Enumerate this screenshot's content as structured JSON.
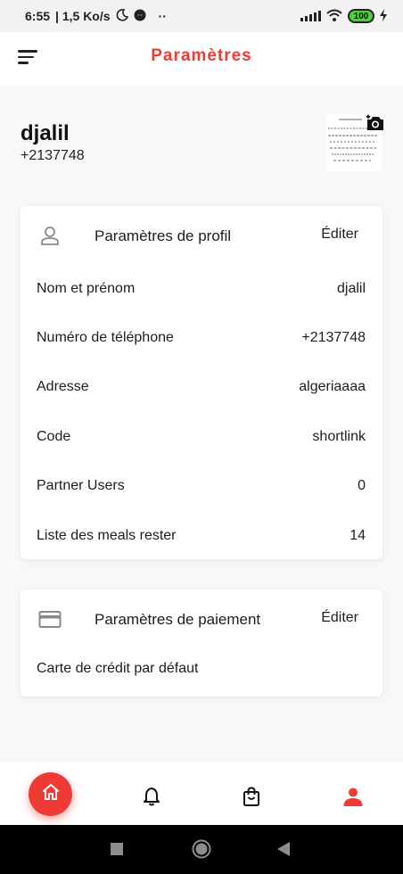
{
  "status_bar": {
    "time": "6:55",
    "speed": "| 1,5 Ko/s",
    "dots": "··",
    "battery": "100"
  },
  "header": {
    "title": "Paramètres"
  },
  "profile": {
    "name": "djalil",
    "phone": "+2137748"
  },
  "profile_settings": {
    "title": "Paramètres de profil",
    "edit_label": "Éditer",
    "rows": [
      {
        "label": "Nom et prénom",
        "value": "djalil"
      },
      {
        "label": "Numéro de téléphone",
        "value": "+2137748"
      },
      {
        "label": "Adresse",
        "value": "algeriaaaa"
      },
      {
        "label": "Code",
        "value": "shortlink"
      },
      {
        "label": "Partner Users",
        "value": "0"
      },
      {
        "label": "Liste des meals rester",
        "value": "14"
      }
    ]
  },
  "payment_settings": {
    "title": "Paramètres de paiement",
    "edit_label": "Éditer",
    "default_card_label": "Carte de crédit par défaut"
  },
  "colors": {
    "accent": "#ef3b36",
    "text": "#1d1d1d",
    "background": "#f8f8f8"
  },
  "bottom_nav": {
    "items": [
      "home-icon",
      "bell-icon",
      "shopping-bag-icon",
      "user-icon"
    ]
  }
}
